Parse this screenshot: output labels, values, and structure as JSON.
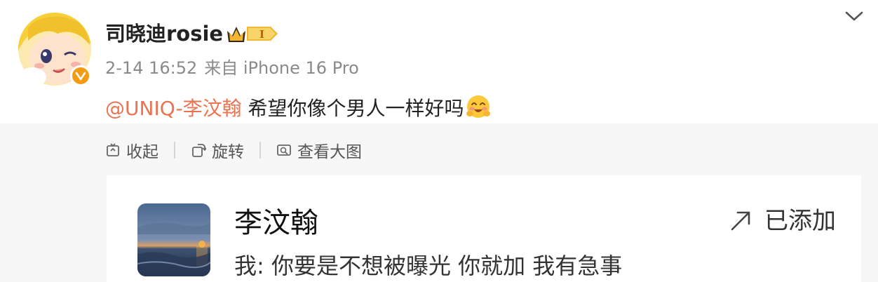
{
  "post": {
    "author": {
      "name": "司晓迪rosie",
      "verified": true,
      "vip_level": "I"
    },
    "meta": {
      "date": "2-14 16:52",
      "source": "来自 iPhone 16 Pro"
    },
    "text": {
      "mention": "@UNIQ-李汶翰",
      "body": " 希望你像个男人一样好吗",
      "emoji": "smiling-blush-emoji"
    },
    "actions": {
      "collapse": "收起",
      "rotate": "旋转",
      "view_large": "查看大图"
    },
    "card": {
      "contact_name": "李汶翰",
      "status": "已添加",
      "message": "我: 你要是不想被曝光 你就加 我有急事"
    }
  },
  "colors": {
    "mention": "#eb7350",
    "badge": "#f39c12",
    "vip_gold": "#f2b632",
    "text_primary": "#222222",
    "text_secondary": "#8a8a8a"
  },
  "icons": [
    "verified-badge-icon",
    "vip-crown-icon",
    "chevron-down-icon",
    "collapse-icon",
    "rotate-icon",
    "view-large-icon",
    "arrow-up-right-icon"
  ]
}
